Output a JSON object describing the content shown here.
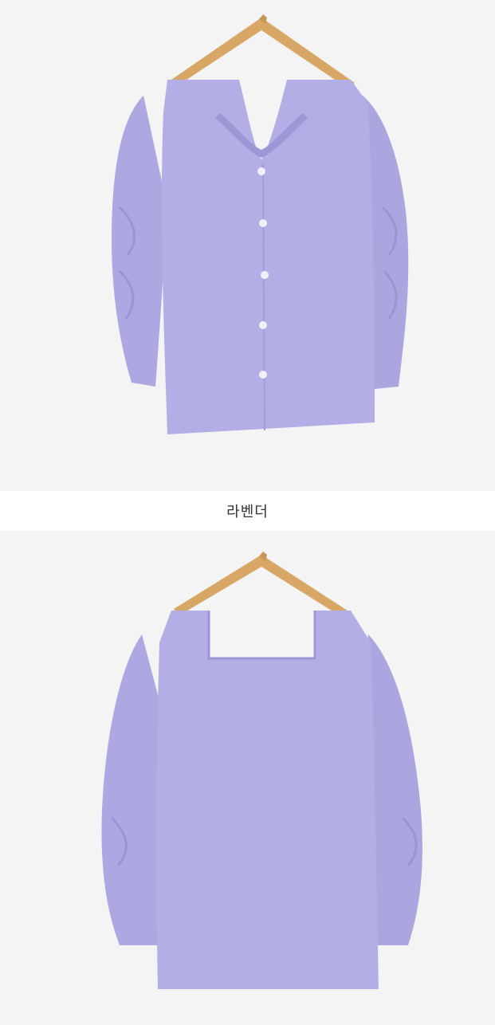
{
  "colors": {
    "background": "#f4f4f4",
    "garment": "#b3aee6",
    "garment_shade": "#9d97d6",
    "hanger": "#d9a86a"
  },
  "caption": {
    "color_name": "라벤더"
  }
}
